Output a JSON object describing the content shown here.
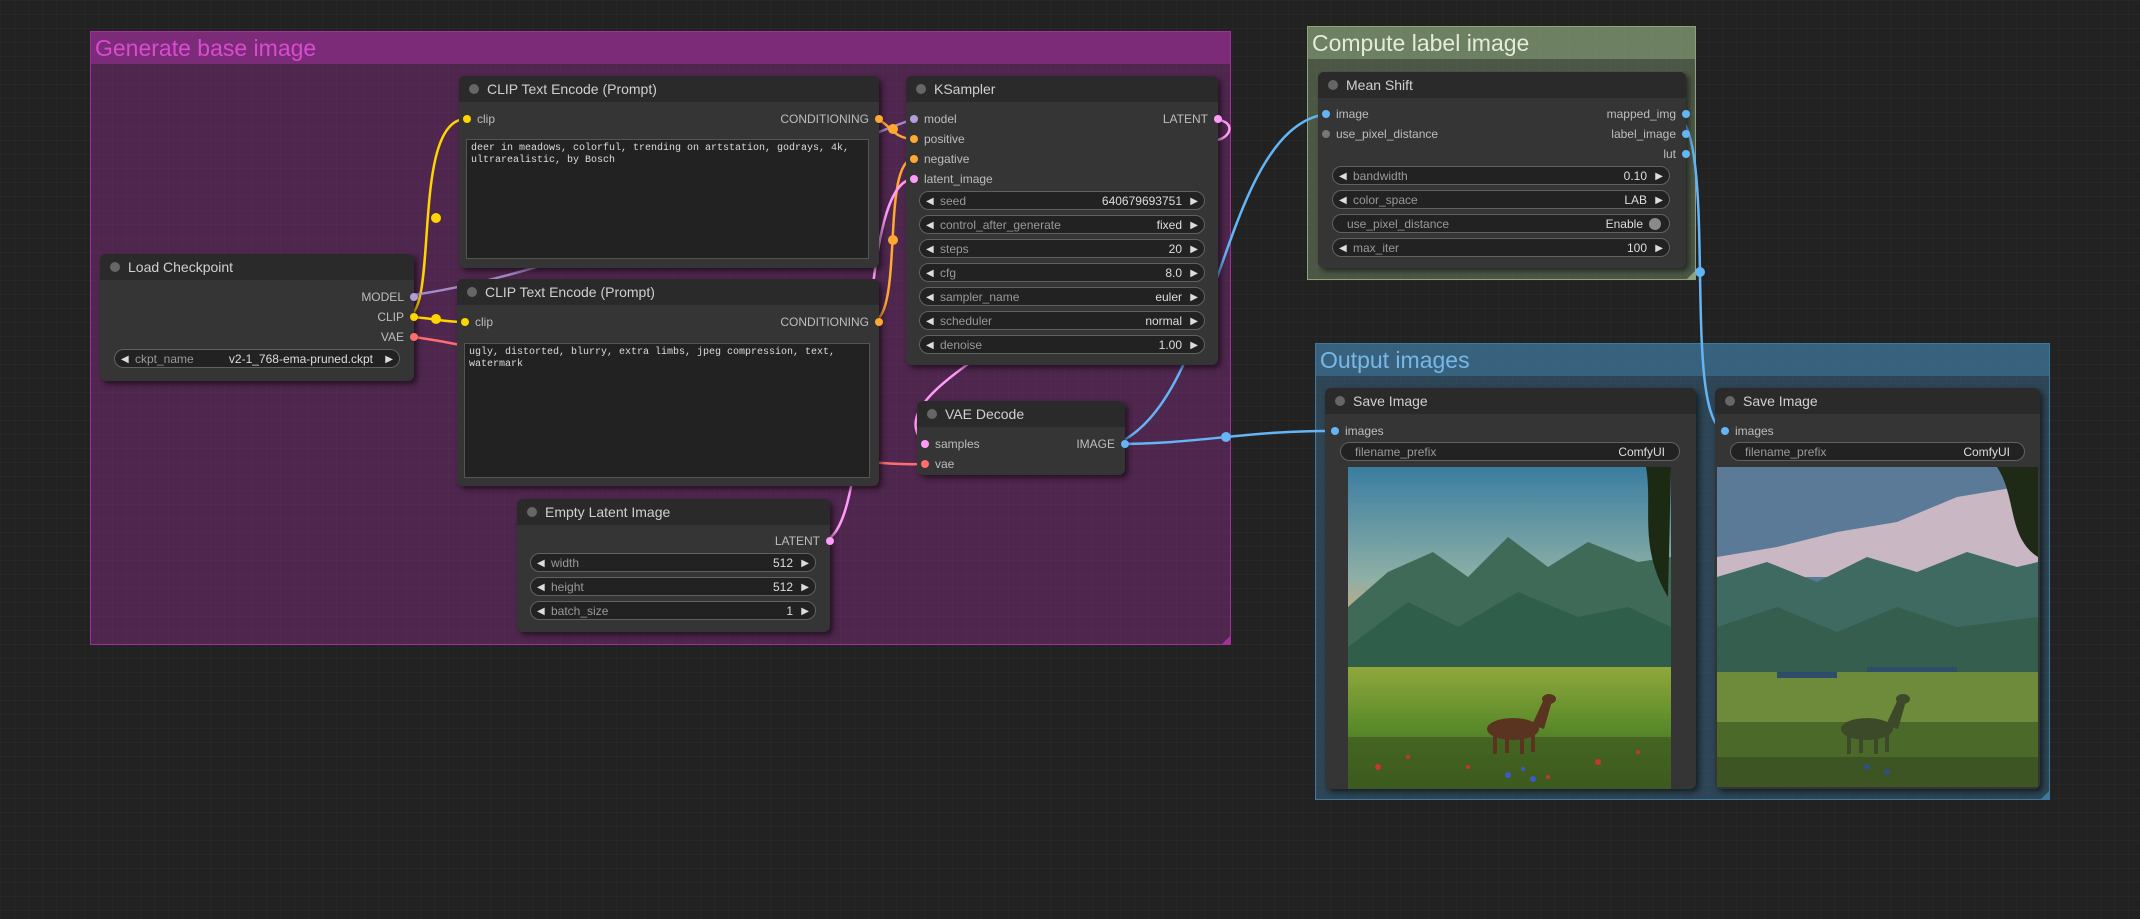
{
  "groups": {
    "generate": {
      "title": "Generate base image"
    },
    "compute": {
      "title": "Compute label image"
    },
    "output": {
      "title": "Output images"
    }
  },
  "nodes": {
    "load_checkpoint": {
      "title": "Load Checkpoint",
      "outputs": [
        "MODEL",
        "CLIP",
        "VAE"
      ],
      "ckpt_name": {
        "label": "ckpt_name",
        "value": "v2-1_768-ema-pruned.ckpt"
      }
    },
    "clip_pos": {
      "title": "CLIP Text Encode (Prompt)",
      "input": "clip",
      "output": "CONDITIONING",
      "text": "deer in meadows, colorful, trending on artstation, godrays, 4k,\nultrarealistic, by Bosch"
    },
    "clip_neg": {
      "title": "CLIP Text Encode (Prompt)",
      "input": "clip",
      "output": "CONDITIONING",
      "text": "ugly, distorted, blurry, extra limbs, jpeg compression, text,\nwatermark"
    },
    "empty_latent": {
      "title": "Empty Latent Image",
      "output": "LATENT",
      "widgets": [
        {
          "label": "width",
          "value": "512"
        },
        {
          "label": "height",
          "value": "512"
        },
        {
          "label": "batch_size",
          "value": "1"
        }
      ]
    },
    "ksampler": {
      "title": "KSampler",
      "inputs": [
        "model",
        "positive",
        "negative",
        "latent_image"
      ],
      "output": "LATENT",
      "widgets": [
        {
          "label": "seed",
          "value": "640679693751"
        },
        {
          "label": "control_after_generate",
          "value": "fixed"
        },
        {
          "label": "steps",
          "value": "20"
        },
        {
          "label": "cfg",
          "value": "8.0"
        },
        {
          "label": "sampler_name",
          "value": "euler"
        },
        {
          "label": "scheduler",
          "value": "normal"
        },
        {
          "label": "denoise",
          "value": "1.00"
        }
      ]
    },
    "vae_decode": {
      "title": "VAE Decode",
      "inputs": [
        "samples",
        "vae"
      ],
      "output": "IMAGE"
    },
    "mean_shift": {
      "title": "Mean Shift",
      "inputs": [
        "image",
        "use_pixel_distance"
      ],
      "outputs": [
        "mapped_img",
        "label_image",
        "lut"
      ],
      "widgets": [
        {
          "label": "bandwidth",
          "value": "0.10"
        },
        {
          "label": "color_space",
          "value": "LAB"
        },
        {
          "label": "use_pixel_distance",
          "value": "Enable"
        },
        {
          "label": "max_iter",
          "value": "100"
        }
      ]
    },
    "save_1": {
      "title": "Save Image",
      "input": "images",
      "filename_prefix": {
        "label": "filename_prefix",
        "value": "ComfyUI"
      }
    },
    "save_2": {
      "title": "Save Image",
      "input": "images",
      "filename_prefix": {
        "label": "filename_prefix",
        "value": "ComfyUI"
      }
    }
  },
  "colors": {
    "model": "#b39ddb",
    "clip": "#ffd500",
    "vae": "#ff6e6e",
    "conditioning": "#ffa931",
    "latent": "#ff9cf9",
    "image": "#64b5f6",
    "generic": "#777777",
    "group_generate": "#a1309b",
    "group_compute": "#8aa37a",
    "group_output": "#3f789e"
  },
  "icons": {
    "arrow_left": "◀",
    "arrow_right": "▶"
  }
}
